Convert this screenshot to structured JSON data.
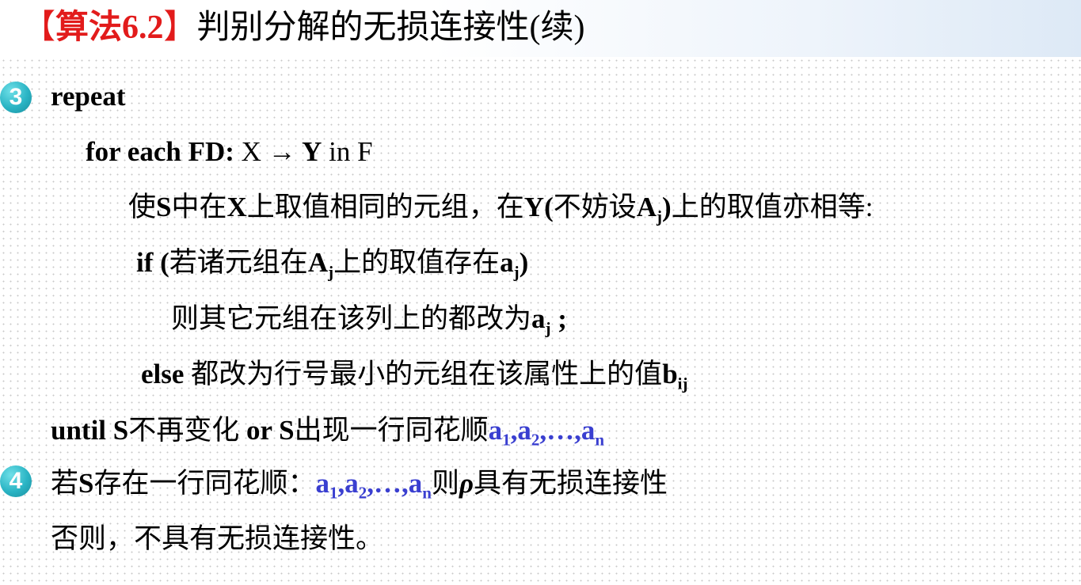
{
  "title": {
    "bracket_open": "【",
    "algo_label": "算法6.2",
    "bracket_close": "】",
    "text": "判别分解的无损连接性(续)"
  },
  "steps": {
    "step3": {
      "number": "3",
      "repeat": "repeat",
      "for_kw": "for  each FD:",
      "for_x": " X ",
      "arrow": "→",
      "for_y": " Y",
      "for_in": "  in F",
      "line_make_equal": {
        "p1": "使",
        "s": "S",
        "p2": "中在",
        "x": "X",
        "p3": "上取值相同的元组，在",
        "y": "Y(",
        "p4": "不妨设",
        "a": "A",
        "j": "j",
        "p5": ")",
        "p6": "上的取值亦相等:"
      },
      "if_line": {
        "kw": "if",
        "p1": "  (",
        "p2": "若诸元组在",
        "a": "A",
        "j": "j",
        "p3": "上的取值存在",
        "aj": "a",
        "j2": "j",
        "p4": ")"
      },
      "then_line": {
        "p1": "则其它元组在该列上的都改为",
        "a": "a",
        "j": "j",
        "p2": " ;"
      },
      "else_line": {
        "kw": "else",
        "p1": "  都改为行号最小的元组在该属性上的值",
        "b": "b",
        "ij": "ij"
      },
      "until_line": {
        "kw": "until  S",
        "p1": "不再变化",
        "or": " or S",
        "p2": "出现一行同花顺",
        "a1": "a",
        "s1": "1",
        "c1": ",a",
        "s2": "2",
        "c2": ",…,a",
        "sn": "n"
      }
    },
    "step4": {
      "number": "4",
      "p1": "若",
      "s": "S",
      "p2": "存在一行同花顺：",
      "a1": "a",
      "s1": "1",
      "c1": ",a",
      "s2": "2",
      "c2": ",…,a",
      "sn": "n",
      "p3": "则",
      "rho": "ρ",
      "p4": "具有无损连接性"
    },
    "otherwise": "否则，不具有无损连接性。"
  },
  "colors": {
    "title_red": "#e21b1b",
    "sequence_blue": "#3a3fd0",
    "number_badge": "#2ab4c4"
  }
}
